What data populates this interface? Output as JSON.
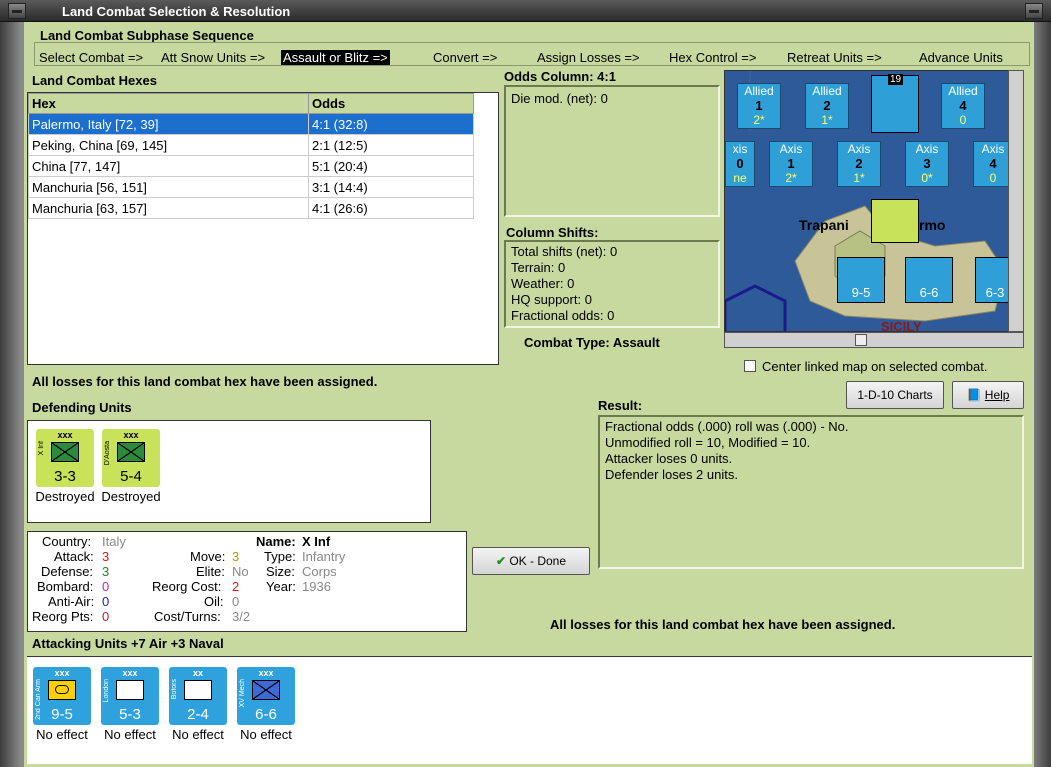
{
  "window": {
    "title": "Land Combat Selection & Resolution"
  },
  "phase": {
    "heading": "Land Combat Subphase Sequence",
    "steps": [
      "Select Combat =>",
      "Att Snow Units =>",
      "Assault or Blitz =>",
      "Convert =>",
      "Assign Losses =>",
      "Hex Control =>",
      "Retreat Units =>",
      "Advance Units"
    ],
    "active_index": 2
  },
  "hexes": {
    "heading": "Land Combat Hexes",
    "col_hex": "Hex",
    "col_odds": "Odds",
    "rows": [
      {
        "hex": "Palermo, Italy [72, 39]",
        "odds": "4:1 (32:8)"
      },
      {
        "hex": "Peking, China [69, 145]",
        "odds": "2:1 (12:5)"
      },
      {
        "hex": "China [77, 147]",
        "odds": "5:1 (20:4)"
      },
      {
        "hex": "Manchuria [56, 151]",
        "odds": "3:1 (14:4)"
      },
      {
        "hex": "Manchuria [63, 157]",
        "odds": "4:1 (26:6)"
      }
    ]
  },
  "odds_column": {
    "heading": "Odds Column: 4:1",
    "die_mod": "Die mod. (net): 0"
  },
  "column_shifts": {
    "heading": "Column Shifts:",
    "lines": [
      "Total shifts (net): 0",
      "Terrain: 0",
      "Weather: 0",
      "HQ support: 0",
      "Fractional odds: 0"
    ]
  },
  "combat_type": "Combat Type:  Assault",
  "map": {
    "allied_boxes": [
      {
        "label": "Allied",
        "num": "1",
        "val": "2*"
      },
      {
        "label": "Allied",
        "num": "2",
        "val": "1*"
      },
      {
        "label": "Allied",
        "num": "4",
        "val": "0"
      }
    ],
    "axis_boxes": [
      {
        "label": "xis",
        "num": "0",
        "val": "ne"
      },
      {
        "label": "Axis",
        "num": "1",
        "val": "2*"
      },
      {
        "label": "Axis",
        "num": "2",
        "val": "1*"
      },
      {
        "label": "Axis",
        "num": "3",
        "val": "0*"
      },
      {
        "label": "Axis",
        "num": "4",
        "val": "0"
      }
    ],
    "places": [
      "Trapani",
      "rmo",
      "SICILY"
    ],
    "stack_count_top": "19",
    "unit_vals": [
      "9-5",
      "6-6",
      "6-3"
    ],
    "center_label": "Center linked map on selected combat."
  },
  "losses_msg": "All losses for this land combat hex have been assigned.",
  "buttons": {
    "charts": "1-D-10 Charts",
    "help": "Help",
    "ok": "OK - Done"
  },
  "defending": {
    "heading": "Defending Units",
    "units": [
      {
        "name": "X Inf",
        "size": "xxx",
        "value": "3-3",
        "status": "Destroyed"
      },
      {
        "name": "D'Aosta",
        "size": "xxx",
        "value": "5-4",
        "status": "Destroyed"
      }
    ]
  },
  "result": {
    "heading": "Result:",
    "lines": [
      "Fractional odds (.000) roll was (.000)  - No.",
      "Unmodified roll = 10, Modified = 10.",
      "Attacker loses 0 units.",
      "Defender loses 2 units."
    ]
  },
  "details": {
    "country_k": "Country:",
    "country_v": "Italy",
    "attack_k": "Attack:",
    "attack_v": "3",
    "defense_k": "Defense:",
    "defense_v": "3",
    "bombard_k": "Bombard:",
    "bombard_v": "0",
    "antiair_k": "Anti-Air:",
    "antiair_v": "0",
    "reorgpts_k": "Reorg Pts:",
    "reorgpts_v": "0",
    "move_k": "Move:",
    "move_v": "3",
    "elite_k": "Elite:",
    "elite_v": "No",
    "reorgcost_k": "Reorg Cost:",
    "reorgcost_v": "2",
    "oil_k": "Oil:",
    "oil_v": "0",
    "costturns_k": "Cost/Turns:",
    "costturns_v": "3/2",
    "name_k": "Name:",
    "name_v": "X Inf",
    "type_k": "Type:",
    "type_v": "Infantry",
    "size_k": "Size:",
    "size_v": "Corps",
    "year_k": "Year:",
    "year_v": "1936"
  },
  "attacking": {
    "heading": "Attacking Units +7 Air +3 Naval",
    "units": [
      {
        "name": "2nd Can Arm",
        "size": "xxx",
        "value": "9-5",
        "status": "No effect"
      },
      {
        "name": "London",
        "size": "xxx",
        "value": "5-3",
        "status": "No effect"
      },
      {
        "name": "Bofors",
        "size": "xx",
        "value": "2-4",
        "status": "No effect"
      },
      {
        "name": "XV Mech",
        "size": "xxx",
        "value": "6-6",
        "status": "No effect"
      }
    ]
  },
  "colors": {
    "panel": "#c8d9a0",
    "axis_unit": "#c8e25a",
    "allied_unit": "#2fa2dd",
    "selection": "#1c6fcd"
  }
}
